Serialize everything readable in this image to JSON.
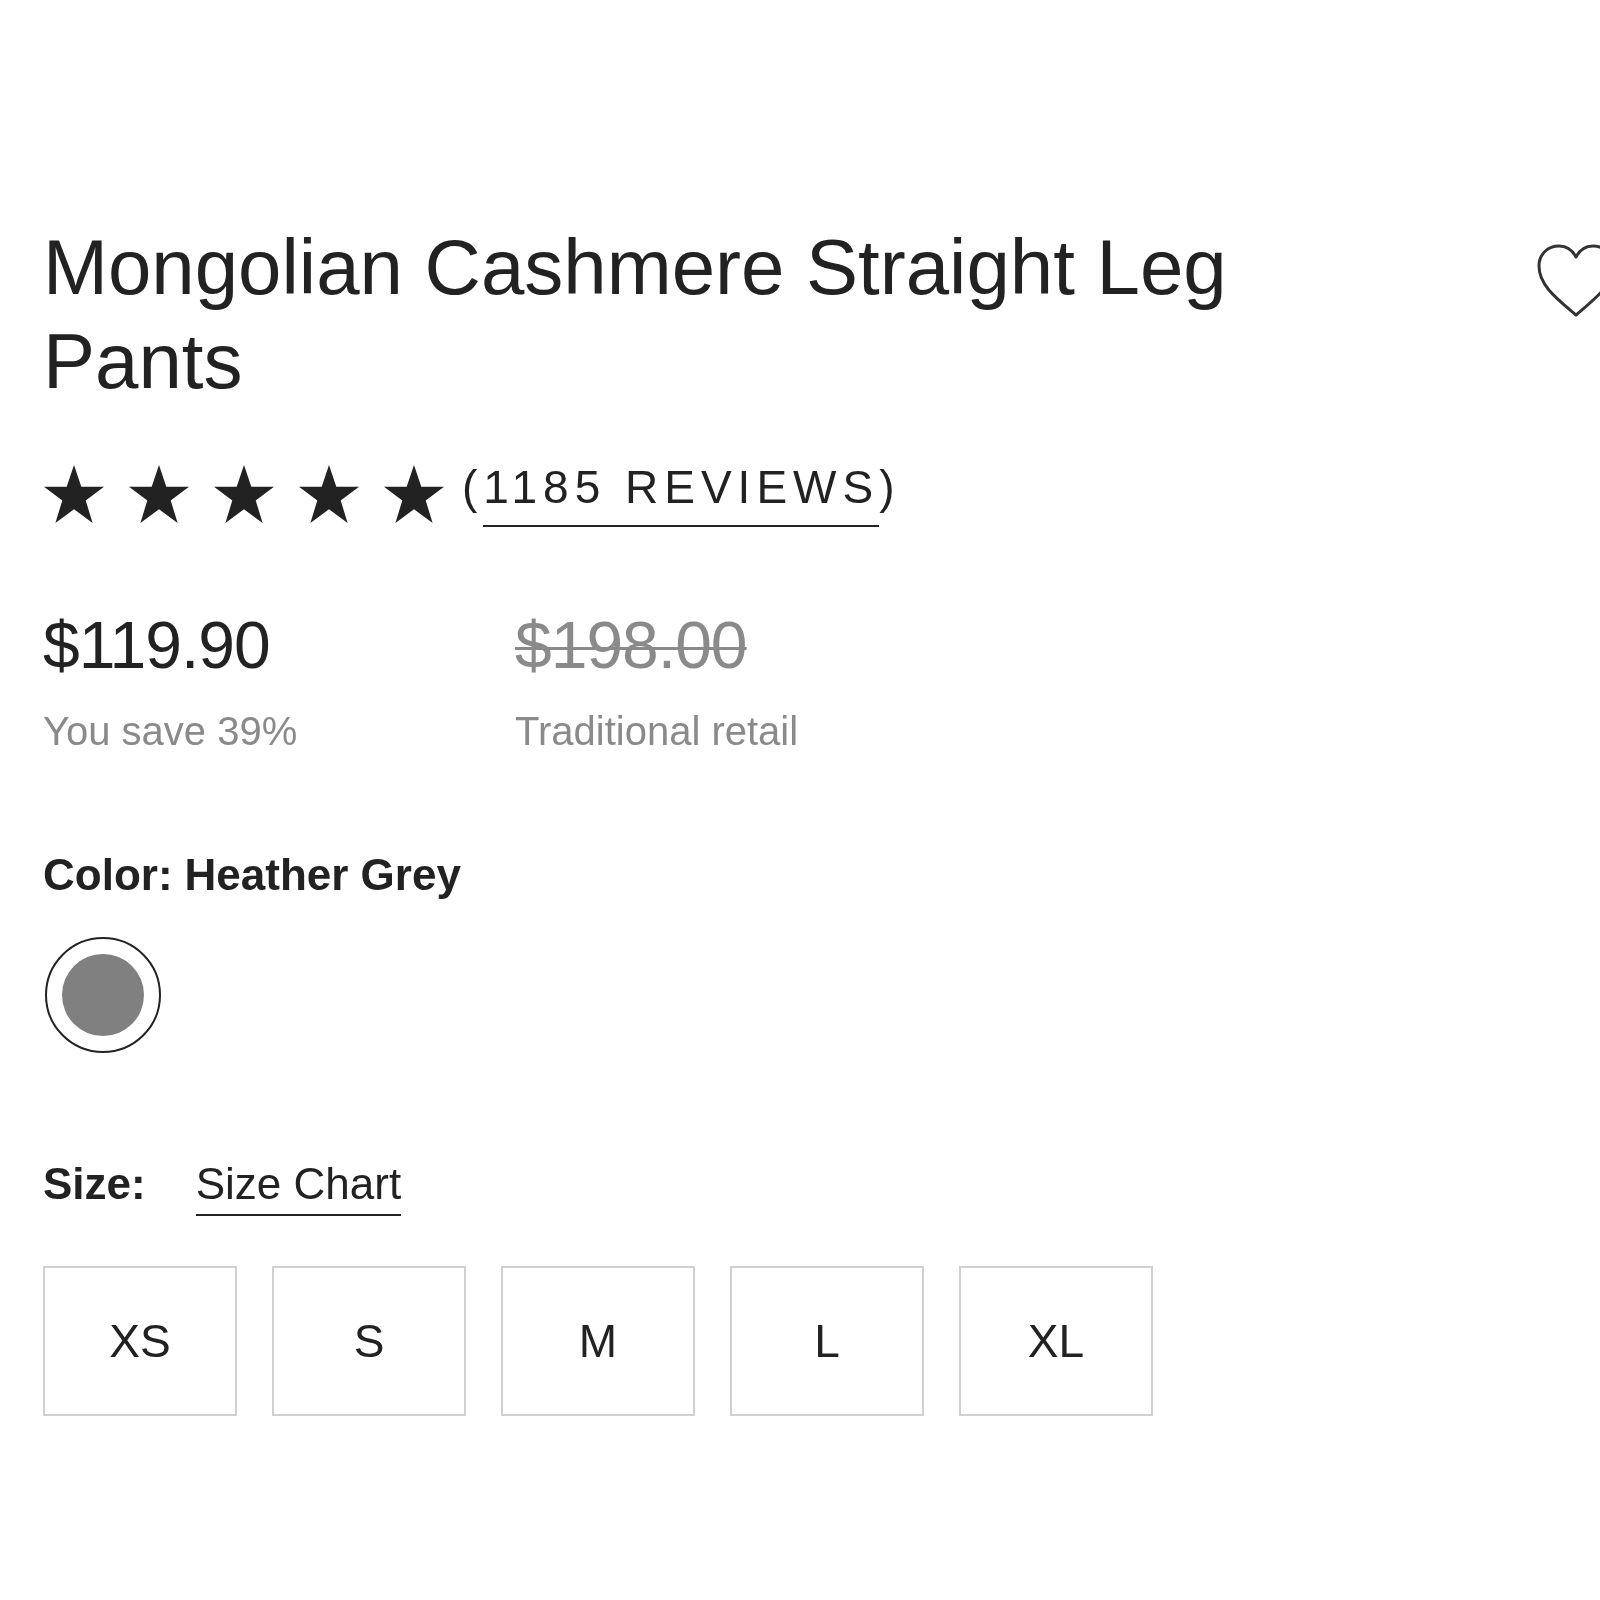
{
  "product": {
    "title": "Mongolian Cashmere Straight Leg Pants",
    "saved": false
  },
  "rating": {
    "stars": 5,
    "reviews_open": "(",
    "reviews_link": "1185 REVIEWS",
    "reviews_close": ")"
  },
  "pricing": [
    {
      "kind": "sale",
      "price": "$119.90",
      "note": "You save 39%"
    },
    {
      "kind": "retail",
      "price": "$198.00",
      "note": "Traditional retail"
    }
  ],
  "color": {
    "label": "Color:",
    "value": "Heather Grey",
    "swatches": [
      {
        "color": "#808080",
        "selected": true
      }
    ]
  },
  "size": {
    "label": "Size:",
    "chart_link": "Size Chart",
    "options": [
      {
        "label": "XS",
        "selected": false
      },
      {
        "label": "S",
        "selected": false
      },
      {
        "label": "M",
        "selected": false
      },
      {
        "label": "L",
        "selected": false
      },
      {
        "label": "XL",
        "selected": false
      }
    ]
  }
}
